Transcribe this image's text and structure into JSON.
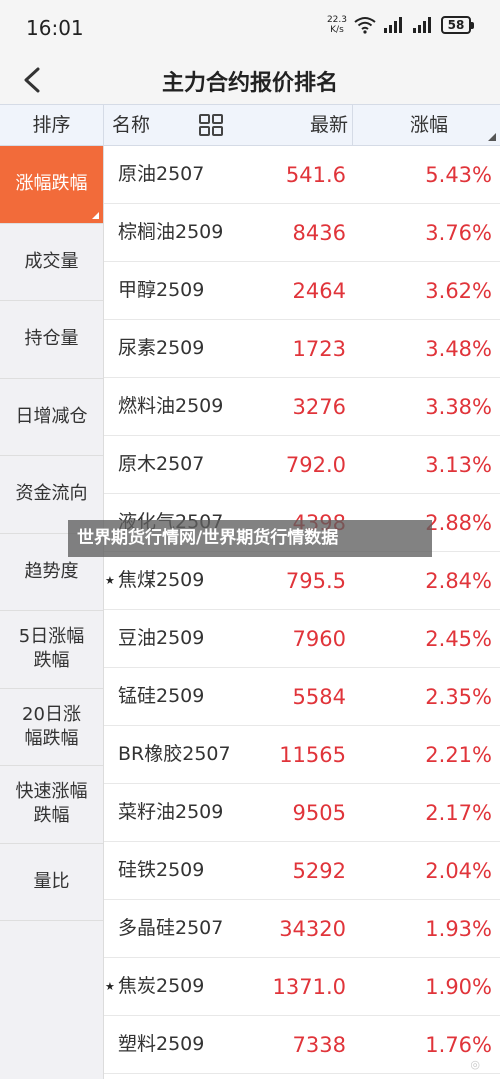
{
  "status_bar": {
    "time": "16:01",
    "net_speed_value": "22.3",
    "net_speed_unit": "K/s",
    "battery": "58"
  },
  "title_bar": {
    "back_icon": "chevron-left-icon",
    "title": "主力合约报价排名"
  },
  "table_header": {
    "sort_label": "排序",
    "name_label": "名称",
    "grid_icon": "grid-icon",
    "latest_label": "最新",
    "change_label": "涨幅"
  },
  "sidebar": {
    "items": [
      {
        "label": "涨幅跌幅",
        "active": true
      },
      {
        "label": "成交量",
        "active": false
      },
      {
        "label": "持仓量",
        "active": false
      },
      {
        "label": "日增减仓",
        "active": false
      },
      {
        "label": "资金流向",
        "active": false
      },
      {
        "label": "趋势度",
        "active": false
      },
      {
        "label": "5日涨幅\n跌幅",
        "active": false
      },
      {
        "label": "20日涨\n幅跌幅",
        "active": false
      },
      {
        "label": "快速涨幅\n跌幅",
        "active": false
      },
      {
        "label": "量比",
        "active": false
      }
    ]
  },
  "rows": [
    {
      "name": "原油2507",
      "price": "541.6",
      "change": "5.43%",
      "star": ""
    },
    {
      "name": "棕榈油2509",
      "price": "8436",
      "change": "3.76%",
      "star": ""
    },
    {
      "name": "甲醇2509",
      "price": "2464",
      "change": "3.62%",
      "star": ""
    },
    {
      "name": "尿素2509",
      "price": "1723",
      "change": "3.48%",
      "star": ""
    },
    {
      "name": "燃料油2509",
      "price": "3276",
      "change": "3.38%",
      "star": ""
    },
    {
      "name": "原木2507",
      "price": "792.0",
      "change": "3.13%",
      "star": ""
    },
    {
      "name": "液化气2507",
      "price": "4398",
      "change": "2.88%",
      "star": ""
    },
    {
      "name": "焦煤2509",
      "price": "795.5",
      "change": "2.84%",
      "star": "★"
    },
    {
      "name": "豆油2509",
      "price": "7960",
      "change": "2.45%",
      "star": ""
    },
    {
      "name": "锰硅2509",
      "price": "5584",
      "change": "2.35%",
      "star": ""
    },
    {
      "name": "BR橡胶2507",
      "price": "11565",
      "change": "2.21%",
      "star": ""
    },
    {
      "name": "菜籽油2509",
      "price": "9505",
      "change": "2.17%",
      "star": ""
    },
    {
      "name": "硅铁2509",
      "price": "5292",
      "change": "2.04%",
      "star": ""
    },
    {
      "name": "多晶硅2507",
      "price": "34320",
      "change": "1.93%",
      "star": ""
    },
    {
      "name": "焦炭2509",
      "price": "1371.0",
      "change": "1.90%",
      "star": "★"
    },
    {
      "name": "塑料2509",
      "price": "7338",
      "change": "1.76%",
      "star": ""
    }
  ],
  "watermark": {
    "text": "世界期货行情网/世界期货行情数据"
  },
  "colors": {
    "accent": "#f26b3a",
    "up": "#e0343a"
  }
}
